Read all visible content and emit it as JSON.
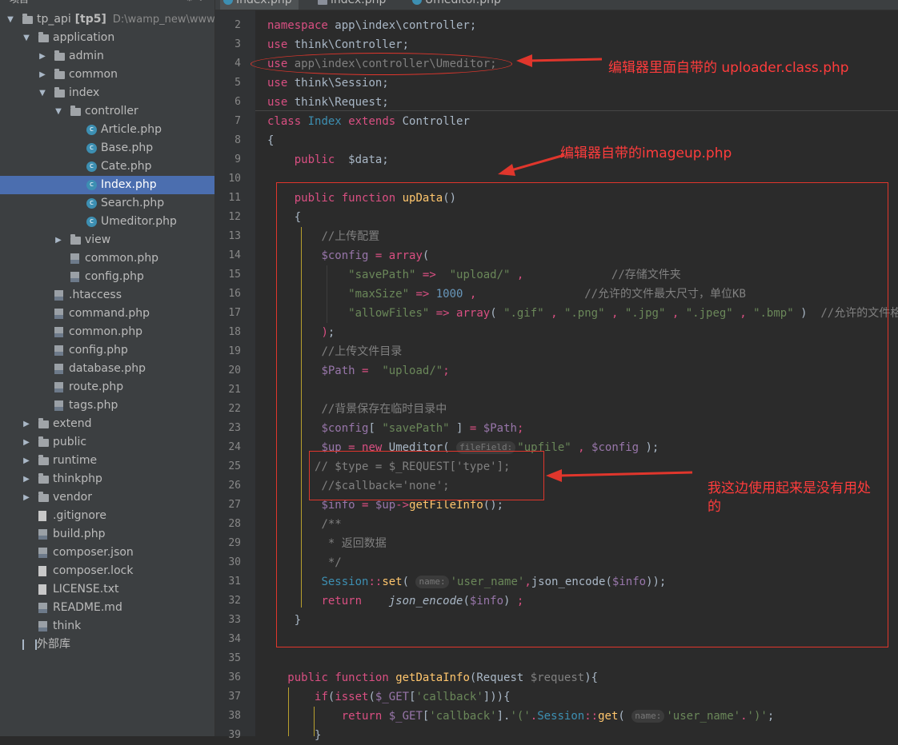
{
  "tree_header": {
    "label": "项目",
    "icons": "⚙ ↕"
  },
  "tree": [
    {
      "label": "tp_api",
      "bold_suffix": "[tp5]",
      "path": "D:\\wamp_new\\www\\tp_",
      "icon": "folder",
      "indent": 0,
      "arrow": "down"
    },
    {
      "label": "application",
      "icon": "folder",
      "indent": 1,
      "arrow": "down"
    },
    {
      "label": "admin",
      "icon": "folder",
      "indent": 2,
      "arrow": "right"
    },
    {
      "label": "common",
      "icon": "folder",
      "indent": 2,
      "arrow": "right"
    },
    {
      "label": "index",
      "icon": "folder",
      "indent": 2,
      "arrow": "down"
    },
    {
      "label": "controller",
      "icon": "folder",
      "indent": 3,
      "arrow": "down"
    },
    {
      "label": "Article.php",
      "icon": "class",
      "indent": 4,
      "arrow": ""
    },
    {
      "label": "Base.php",
      "icon": "class",
      "indent": 4,
      "arrow": ""
    },
    {
      "label": "Cate.php",
      "icon": "class",
      "indent": 4,
      "arrow": ""
    },
    {
      "label": "Index.php",
      "icon": "class",
      "indent": 4,
      "arrow": "",
      "selected": true
    },
    {
      "label": "Search.php",
      "icon": "class",
      "indent": 4,
      "arrow": ""
    },
    {
      "label": "Umeditor.php",
      "icon": "class",
      "indent": 4,
      "arrow": ""
    },
    {
      "label": "view",
      "icon": "folder",
      "indent": 3,
      "arrow": "right"
    },
    {
      "label": "common.php",
      "icon": "php",
      "indent": 3,
      "arrow": ""
    },
    {
      "label": "config.php",
      "icon": "php",
      "indent": 3,
      "arrow": ""
    },
    {
      "label": ".htaccess",
      "icon": "php",
      "indent": 2,
      "arrow": ""
    },
    {
      "label": "command.php",
      "icon": "php",
      "indent": 2,
      "arrow": ""
    },
    {
      "label": "common.php",
      "icon": "php",
      "indent": 2,
      "arrow": ""
    },
    {
      "label": "config.php",
      "icon": "php",
      "indent": 2,
      "arrow": ""
    },
    {
      "label": "database.php",
      "icon": "php",
      "indent": 2,
      "arrow": ""
    },
    {
      "label": "route.php",
      "icon": "php",
      "indent": 2,
      "arrow": ""
    },
    {
      "label": "tags.php",
      "icon": "php",
      "indent": 2,
      "arrow": ""
    },
    {
      "label": "extend",
      "icon": "folder",
      "indent": 1,
      "arrow": "right"
    },
    {
      "label": "public",
      "icon": "folder",
      "indent": 1,
      "arrow": "right"
    },
    {
      "label": "runtime",
      "icon": "folder",
      "indent": 1,
      "arrow": "right"
    },
    {
      "label": "thinkphp",
      "icon": "folder",
      "indent": 1,
      "arrow": "right"
    },
    {
      "label": "vendor",
      "icon": "folder",
      "indent": 1,
      "arrow": "right"
    },
    {
      "label": ".gitignore",
      "icon": "plain",
      "indent": 1,
      "arrow": ""
    },
    {
      "label": "build.php",
      "icon": "php",
      "indent": 1,
      "arrow": ""
    },
    {
      "label": "composer.json",
      "icon": "php",
      "indent": 1,
      "arrow": ""
    },
    {
      "label": "composer.lock",
      "icon": "plain",
      "indent": 1,
      "arrow": ""
    },
    {
      "label": "LICENSE.txt",
      "icon": "plain",
      "indent": 1,
      "arrow": ""
    },
    {
      "label": "README.md",
      "icon": "php",
      "indent": 1,
      "arrow": ""
    },
    {
      "label": "think",
      "icon": "php",
      "indent": 1,
      "arrow": ""
    },
    {
      "label": "外部库",
      "icon": "lib",
      "indent": 0,
      "arrow": ""
    }
  ],
  "tabs": [
    {
      "label": "Index.php",
      "icon": "class",
      "active": true
    },
    {
      "label": "index.php",
      "icon": "php",
      "active": false
    },
    {
      "label": "Umeditor.php",
      "icon": "class",
      "active": false
    }
  ],
  "code": [
    {
      "n": "2",
      "tokens": [
        [
          "kw",
          "namespace"
        ],
        [
          "t",
          " app\\index\\controller;"
        ]
      ]
    },
    {
      "n": "3",
      "tokens": [
        [
          "kw",
          "use"
        ],
        [
          "t",
          " think\\Controller;"
        ]
      ]
    },
    {
      "n": "4",
      "tokens": [
        [
          "kw",
          "use"
        ],
        [
          "c",
          " app\\index\\controller\\Umeditor;"
        ]
      ]
    },
    {
      "n": "5",
      "tokens": [
        [
          "kw",
          "use"
        ],
        [
          "t",
          " think\\Session;"
        ]
      ]
    },
    {
      "n": "6",
      "tokens": [
        [
          "kw",
          "use"
        ],
        [
          "t",
          " think\\Request;"
        ]
      ]
    },
    {
      "n": "7",
      "tokens": [
        [
          "kw",
          "class"
        ],
        [
          "t",
          " "
        ],
        [
          "cls2",
          "Index"
        ],
        [
          "t",
          " "
        ],
        [
          "kw",
          "extends"
        ],
        [
          "t",
          " Controller"
        ]
      ]
    },
    {
      "n": "8",
      "tokens": [
        [
          "t",
          "{"
        ]
      ]
    },
    {
      "n": "9",
      "tokens": [
        [
          "t",
          "    "
        ],
        [
          "kw",
          "public"
        ],
        [
          "t",
          "  $data;"
        ]
      ]
    },
    {
      "n": "10",
      "tokens": []
    },
    {
      "n": "11",
      "tokens": [
        [
          "t",
          "    "
        ],
        [
          "kw",
          "public"
        ],
        [
          "t",
          " "
        ],
        [
          "kw",
          "function"
        ],
        [
          "t",
          " "
        ],
        [
          "f",
          "upData"
        ],
        [
          "t",
          "()"
        ]
      ]
    },
    {
      "n": "12",
      "tokens": [
        [
          "t",
          "    {"
        ]
      ]
    },
    {
      "n": "13",
      "tokens": [
        [
          "t",
          "        "
        ],
        [
          "c",
          "//上传配置"
        ]
      ]
    },
    {
      "n": "14",
      "tokens": [
        [
          "t",
          "        "
        ],
        [
          "v",
          "$config"
        ],
        [
          "t",
          " "
        ],
        [
          "kw",
          "="
        ],
        [
          "t",
          " "
        ],
        [
          "kw",
          "array"
        ],
        [
          "t",
          "("
        ]
      ]
    },
    {
      "n": "15",
      "tokens": [
        [
          "t",
          "            "
        ],
        [
          "s",
          "\"savePath\""
        ],
        [
          "t",
          " "
        ],
        [
          "kw",
          "=>"
        ],
        [
          "t",
          "  "
        ],
        [
          "s",
          "\"upload/\""
        ],
        [
          "t",
          " "
        ],
        [
          "kw",
          ","
        ],
        [
          "t",
          "             "
        ],
        [
          "c",
          "//存储文件夹"
        ]
      ]
    },
    {
      "n": "16",
      "tokens": [
        [
          "t",
          "            "
        ],
        [
          "s",
          "\"maxSize\""
        ],
        [
          "t",
          " "
        ],
        [
          "kw",
          "=>"
        ],
        [
          "t",
          " "
        ],
        [
          "n",
          "1000"
        ],
        [
          "t",
          " "
        ],
        [
          "kw",
          ","
        ],
        [
          "t",
          "                "
        ],
        [
          "c",
          "//允许的文件最大尺寸，单位KB"
        ]
      ]
    },
    {
      "n": "17",
      "tokens": [
        [
          "t",
          "            "
        ],
        [
          "s",
          "\"allowFiles\""
        ],
        [
          "t",
          " "
        ],
        [
          "kw",
          "=>"
        ],
        [
          "t",
          " "
        ],
        [
          "kw",
          "array"
        ],
        [
          "t",
          "( "
        ],
        [
          "s",
          "\".gif\""
        ],
        [
          "t",
          " "
        ],
        [
          "kw",
          ","
        ],
        [
          "t",
          " "
        ],
        [
          "s",
          "\".png\""
        ],
        [
          "t",
          " "
        ],
        [
          "kw",
          ","
        ],
        [
          "t",
          " "
        ],
        [
          "s",
          "\".jpg\""
        ],
        [
          "t",
          " "
        ],
        [
          "kw",
          ","
        ],
        [
          "t",
          " "
        ],
        [
          "s",
          "\".jpeg\""
        ],
        [
          "t",
          " "
        ],
        [
          "kw",
          ","
        ],
        [
          "t",
          " "
        ],
        [
          "s",
          "\".bmp\""
        ],
        [
          "t",
          " )  "
        ],
        [
          "c",
          "//允许的文件格式"
        ]
      ]
    },
    {
      "n": "18",
      "tokens": [
        [
          "t",
          "        "
        ],
        [
          "kw",
          ")"
        ],
        [
          "t",
          ";"
        ]
      ]
    },
    {
      "n": "19",
      "tokens": [
        [
          "t",
          "        "
        ],
        [
          "c",
          "//上传文件目录"
        ]
      ]
    },
    {
      "n": "20",
      "tokens": [
        [
          "t",
          "        "
        ],
        [
          "v",
          "$Path"
        ],
        [
          "t",
          " "
        ],
        [
          "kw",
          "="
        ],
        [
          "t",
          "  "
        ],
        [
          "s",
          "\"upload/\""
        ],
        [
          "kw",
          ";"
        ]
      ]
    },
    {
      "n": "21",
      "tokens": []
    },
    {
      "n": "22",
      "tokens": [
        [
          "t",
          "        "
        ],
        [
          "c",
          "//背景保存在临时目录中"
        ]
      ]
    },
    {
      "n": "23",
      "tokens": [
        [
          "t",
          "        "
        ],
        [
          "v",
          "$config"
        ],
        [
          "t",
          "[ "
        ],
        [
          "s",
          "\"savePath\""
        ],
        [
          "t",
          " ] "
        ],
        [
          "kw",
          "="
        ],
        [
          "t",
          " "
        ],
        [
          "v",
          "$Path"
        ],
        [
          "kw",
          ";"
        ]
      ]
    },
    {
      "n": "24",
      "tokens": [
        [
          "t",
          "        "
        ],
        [
          "v",
          "$up"
        ],
        [
          "t",
          " "
        ],
        [
          "kw",
          "="
        ],
        [
          "t",
          " "
        ],
        [
          "kw",
          "new"
        ],
        [
          "t",
          " Umeditor( "
        ],
        [
          "hint",
          "fileField:"
        ],
        [
          "s",
          "\"upfile\""
        ],
        [
          "t",
          " "
        ],
        [
          "kw",
          ","
        ],
        [
          "t",
          " "
        ],
        [
          "v",
          "$config"
        ],
        [
          "t",
          " );"
        ]
      ]
    },
    {
      "n": "25",
      "tokens": [
        [
          "t",
          "       "
        ],
        [
          "c",
          "// $type = $_REQUEST['type'];"
        ]
      ]
    },
    {
      "n": "26",
      "tokens": [
        [
          "t",
          "        "
        ],
        [
          "c",
          "//$callback='none';"
        ]
      ]
    },
    {
      "n": "27",
      "tokens": [
        [
          "t",
          "        "
        ],
        [
          "v",
          "$info"
        ],
        [
          "t",
          " "
        ],
        [
          "kw",
          "="
        ],
        [
          "t",
          " "
        ],
        [
          "v",
          "$up"
        ],
        [
          "kw",
          "->"
        ],
        [
          "f",
          "getFileInfo"
        ],
        [
          "t",
          "();"
        ]
      ]
    },
    {
      "n": "28",
      "tokens": [
        [
          "t",
          "        "
        ],
        [
          "c",
          "/**"
        ]
      ]
    },
    {
      "n": "29",
      "tokens": [
        [
          "t",
          "         "
        ],
        [
          "c",
          "* 返回数据"
        ]
      ]
    },
    {
      "n": "30",
      "tokens": [
        [
          "t",
          "         "
        ],
        [
          "c",
          "*/"
        ]
      ]
    },
    {
      "n": "31",
      "tokens": [
        [
          "t",
          "        "
        ],
        [
          "cls2",
          "Session"
        ],
        [
          "kw",
          "::"
        ],
        [
          "f",
          "set"
        ],
        [
          "t",
          "( "
        ],
        [
          "hint",
          "name:"
        ],
        [
          "s",
          "'user_name'"
        ],
        [
          "kw",
          ","
        ],
        [
          "t",
          "json_encode("
        ],
        [
          "v",
          "$info"
        ],
        [
          "t",
          "));"
        ]
      ]
    },
    {
      "n": "32",
      "tokens": [
        [
          "t",
          "        "
        ],
        [
          "kw",
          "return"
        ],
        [
          "t",
          "    "
        ],
        [
          "ital",
          "json_encode"
        ],
        [
          "t",
          "("
        ],
        [
          "v",
          "$info"
        ],
        [
          "t",
          ") "
        ],
        [
          "kw",
          ";"
        ]
      ]
    },
    {
      "n": "33",
      "tokens": [
        [
          "t",
          "    }"
        ]
      ]
    },
    {
      "n": "34",
      "tokens": []
    },
    {
      "n": "35",
      "tokens": []
    },
    {
      "n": "36",
      "tokens": [
        [
          "t",
          "   "
        ],
        [
          "kw",
          "public"
        ],
        [
          "t",
          " "
        ],
        [
          "kw",
          "function"
        ],
        [
          "t",
          " "
        ],
        [
          "f",
          "getDataInfo"
        ],
        [
          "t",
          "(Request "
        ],
        [
          "c",
          "$request"
        ],
        [
          "t",
          "){"
        ]
      ]
    },
    {
      "n": "37",
      "tokens": [
        [
          "t",
          "       "
        ],
        [
          "kw",
          "if"
        ],
        [
          "t",
          "("
        ],
        [
          "kw",
          "isset"
        ],
        [
          "t",
          "("
        ],
        [
          "v",
          "$_GET"
        ],
        [
          "t",
          "["
        ],
        [
          "s",
          "'callback'"
        ],
        [
          "t",
          "])){"
        ]
      ]
    },
    {
      "n": "38",
      "tokens": [
        [
          "t",
          "           "
        ],
        [
          "kw",
          "return"
        ],
        [
          "t",
          " "
        ],
        [
          "v",
          "$_GET"
        ],
        [
          "t",
          "["
        ],
        [
          "s",
          "'callback'"
        ],
        [
          "t",
          "]."
        ],
        [
          "s",
          "'('"
        ],
        [
          "kw",
          "."
        ],
        [
          "cls2",
          "Session"
        ],
        [
          "kw",
          "::"
        ],
        [
          "f",
          "get"
        ],
        [
          "t",
          "( "
        ],
        [
          "hint",
          "name:"
        ],
        [
          "s",
          "'user_name'"
        ],
        [
          "t,"
        ],
        [
          "kw",
          "."
        ],
        [
          "s",
          "')'"
        ],
        [
          "t",
          ";"
        ]
      ]
    },
    {
      "n": "39",
      "tokens": [
        [
          "t",
          "       "
        ],
        [
          "t",
          "}"
        ]
      ]
    }
  ],
  "annotations": {
    "note1": "编辑器里面自带的 uploader.class.php",
    "note2": "编辑器自带的imageup.php",
    "note3_line1": "我这边使用起来是没有用处",
    "note3_line2": "的"
  },
  "colors": {
    "accent": "#4b6eaf",
    "annotation": "#e0362c",
    "keyword": "#d94f82"
  }
}
